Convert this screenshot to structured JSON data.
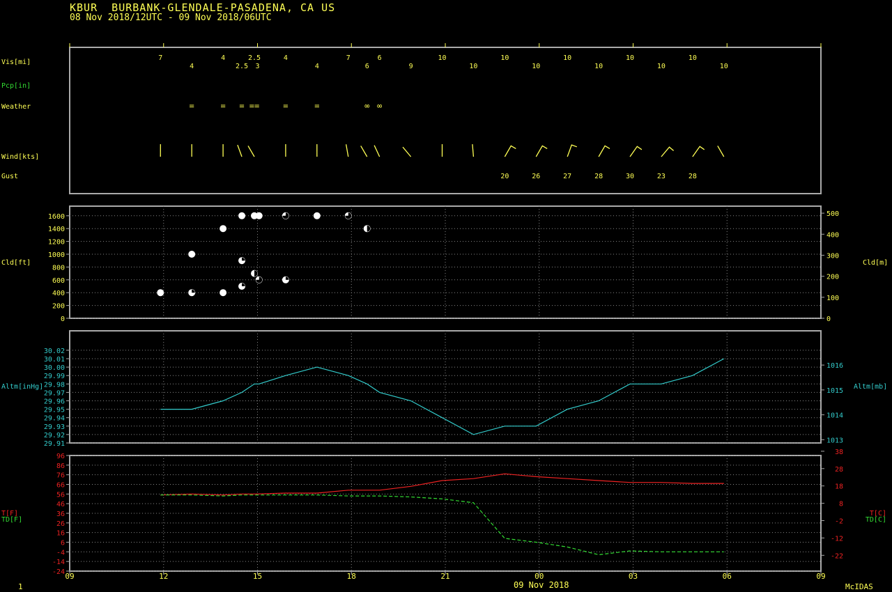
{
  "header": {
    "station": "KBUR  BURBANK-GLENDALE-PASADENA, CA US",
    "period": "08 Nov 2018/12UTC - 09 Nov 2018/06UTC"
  },
  "footer": {
    "frame": "1",
    "credit": "McIDAS",
    "date": "09 Nov 2018"
  },
  "colors": {
    "yellow": "#ffff55",
    "green": "#33dd33",
    "cyan": "#33cccc",
    "red": "#ee2222",
    "grid": "#888888",
    "frame": "#aaaaaa"
  },
  "chart_data": [
    {
      "panel": "surface-weather",
      "type": "table",
      "row_labels": {
        "vis": "Vis[mi]",
        "pcp": "Pcp[in]",
        "weather": "Weather",
        "wind": "Wind[kts]",
        "gust": "Gust"
      },
      "visibility": [
        {
          "t": 11.9,
          "v": "7"
        },
        {
          "t": 12.9,
          "v": "4"
        },
        {
          "t": 13.9,
          "v": "4"
        },
        {
          "t": 14.5,
          "v": "2.5"
        },
        {
          "t": 14.9,
          "v": "2.5"
        },
        {
          "t": 15.0,
          "v": "3"
        },
        {
          "t": 15.9,
          "v": "4"
        },
        {
          "t": 16.9,
          "v": "4"
        },
        {
          "t": 17.9,
          "v": "7"
        },
        {
          "t": 18.5,
          "v": "6"
        },
        {
          "t": 18.9,
          "v": "6"
        },
        {
          "t": 19.9,
          "v": "9"
        },
        {
          "t": 20.9,
          "v": "10"
        },
        {
          "t": 21.9,
          "v": "10"
        },
        {
          "t": 22.9,
          "v": "10"
        },
        {
          "t": 23.9,
          "v": "10"
        },
        {
          "t": 24.9,
          "v": "10"
        },
        {
          "t": 25.9,
          "v": "10"
        },
        {
          "t": 26.9,
          "v": "10"
        },
        {
          "t": 27.9,
          "v": "10"
        },
        {
          "t": 28.9,
          "v": "10"
        },
        {
          "t": 29.9,
          "v": "10"
        }
      ],
      "weather": [
        {
          "t": 12.9,
          "sym": "="
        },
        {
          "t": 13.9,
          "sym": "="
        },
        {
          "t": 14.5,
          "sym": "="
        },
        {
          "t": 14.9,
          "sym": "=="
        },
        {
          "t": 15.9,
          "sym": "="
        },
        {
          "t": 16.9,
          "sym": "="
        },
        {
          "t": 18.5,
          "sym": "∞"
        },
        {
          "t": 18.9,
          "sym": "∞"
        }
      ],
      "wind_barbs": [
        {
          "t": 11.9,
          "dir": 360,
          "spd": 0
        },
        {
          "t": 12.9,
          "dir": 360,
          "spd": 0
        },
        {
          "t": 13.9,
          "dir": 360,
          "spd": 0
        },
        {
          "t": 14.5,
          "dir": 340,
          "spd": 0
        },
        {
          "t": 14.9,
          "dir": 330,
          "spd": 0
        },
        {
          "t": 15.9,
          "dir": 360,
          "spd": 0
        },
        {
          "t": 16.9,
          "dir": 360,
          "spd": 0
        },
        {
          "t": 17.9,
          "dir": 350,
          "spd": 0
        },
        {
          "t": 18.5,
          "dir": 330,
          "spd": 0
        },
        {
          "t": 18.9,
          "dir": 335,
          "spd": 0
        },
        {
          "t": 19.9,
          "dir": 320,
          "spd": 0
        },
        {
          "t": 20.9,
          "dir": 360,
          "spd": 0
        },
        {
          "t": 21.9,
          "dir": 355,
          "spd": 0
        },
        {
          "t": 22.9,
          "dir": 30,
          "spd": 20
        },
        {
          "t": 23.9,
          "dir": 30,
          "spd": 20
        },
        {
          "t": 24.9,
          "dir": 20,
          "spd": 20
        },
        {
          "t": 25.9,
          "dir": 30,
          "spd": 20
        },
        {
          "t": 26.9,
          "dir": 35,
          "spd": 20
        },
        {
          "t": 27.9,
          "dir": 40,
          "spd": 20
        },
        {
          "t": 28.9,
          "dir": 35,
          "spd": 20
        },
        {
          "t": 29.9,
          "dir": 330,
          "spd": 0
        }
      ],
      "gusts": [
        {
          "t": 22.9,
          "v": "20"
        },
        {
          "t": 23.9,
          "v": "26"
        },
        {
          "t": 24.9,
          "v": "27"
        },
        {
          "t": 25.9,
          "v": "28"
        },
        {
          "t": 26.9,
          "v": "30"
        },
        {
          "t": 27.9,
          "v": "23"
        },
        {
          "t": 28.9,
          "v": "28"
        }
      ]
    },
    {
      "panel": "cloud",
      "type": "scatter",
      "ylabel": "Cld[ft]",
      "ylabel_right": "Cld[m]",
      "ylim": [
        0,
        1750
      ],
      "yticks": [
        0,
        200,
        400,
        600,
        800,
        1000,
        1200,
        1400,
        1600
      ],
      "yticks_right": [
        0,
        100,
        200,
        300,
        400,
        500
      ],
      "points": [
        {
          "t": 11.9,
          "ft": 400,
          "cover": 0
        },
        {
          "t": 12.9,
          "ft": 1000,
          "cover": 0
        },
        {
          "t": 12.9,
          "ft": 400,
          "cover": 1
        },
        {
          "t": 13.9,
          "ft": 1400,
          "cover": 0
        },
        {
          "t": 13.9,
          "ft": 400,
          "cover": 0
        },
        {
          "t": 14.5,
          "ft": 1600,
          "cover": 0
        },
        {
          "t": 14.5,
          "ft": 900,
          "cover": 1
        },
        {
          "t": 14.5,
          "ft": 500,
          "cover": 1
        },
        {
          "t": 14.9,
          "ft": 1600,
          "cover": 0
        },
        {
          "t": 14.9,
          "ft": 700,
          "cover": 2
        },
        {
          "t": 15.05,
          "ft": 1600,
          "cover": 0
        },
        {
          "t": 15.05,
          "ft": 600,
          "cover": 3
        },
        {
          "t": 15.9,
          "ft": 1600,
          "cover": 3
        },
        {
          "t": 15.9,
          "ft": 600,
          "cover": 1
        },
        {
          "t": 16.9,
          "ft": 1600,
          "cover": 0
        },
        {
          "t": 17.9,
          "ft": 1600,
          "cover": 3
        },
        {
          "t": 18.5,
          "ft": 1400,
          "cover": 2
        }
      ]
    },
    {
      "panel": "altimeter",
      "type": "line",
      "ylabel": "Altm[inHg]",
      "ylabel_right": "Altm[mb]",
      "ylim": [
        29.91,
        30.02
      ],
      "yticks": [
        "29.91",
        "29.92",
        "29.93",
        "29.94",
        "29.95",
        "29.96",
        "29.97",
        "29.98",
        "29.99",
        "30.00",
        "30.01",
        "30.02"
      ],
      "yticks_right": [
        1013,
        1014,
        1015,
        1016
      ],
      "x": [
        11.9,
        12.9,
        13.9,
        14.5,
        14.9,
        15.05,
        15.9,
        16.9,
        17.9,
        18.5,
        18.9,
        19.9,
        20.9,
        21.9,
        22.9,
        23.9,
        24.9,
        25.9,
        26.9,
        27.9,
        28.9,
        29.9
      ],
      "values": [
        29.95,
        29.95,
        29.96,
        29.97,
        29.98,
        29.98,
        29.99,
        30.0,
        29.99,
        29.98,
        29.97,
        29.96,
        29.94,
        29.92,
        29.93,
        29.93,
        29.95,
        29.96,
        29.98,
        29.98,
        29.99,
        30.01
      ]
    },
    {
      "panel": "temperature",
      "type": "line",
      "ylabel": "T[F]",
      "ylabel2": "TD[F]",
      "ylabel_right": "T[C]",
      "ylabel_right2": "TD[C]",
      "ylim": [
        -24,
        96
      ],
      "yticks": [
        -24,
        -14,
        -4,
        6,
        16,
        26,
        36,
        46,
        56,
        66,
        76,
        86,
        96
      ],
      "yticks_right": [
        -22,
        -12,
        -2,
        8,
        18,
        28,
        38
      ],
      "x": [
        11.9,
        12.9,
        13.9,
        14.5,
        14.9,
        15.9,
        16.9,
        17.9,
        18.9,
        19.9,
        20.9,
        21.9,
        22.9,
        23.9,
        24.9,
        25.9,
        26.9,
        27.9,
        28.9,
        29.9
      ],
      "series": [
        {
          "name": "T[F]",
          "values": [
            55,
            56,
            55,
            56,
            56,
            57,
            57,
            60,
            60,
            64,
            70,
            72,
            77,
            74,
            72,
            70,
            68,
            68,
            67,
            67
          ]
        },
        {
          "name": "TD[F]",
          "values": [
            55,
            55,
            54,
            55,
            55,
            55,
            55,
            54,
            54,
            53,
            51,
            47,
            10,
            6,
            1,
            -7,
            -3,
            -4,
            -4,
            -4
          ]
        }
      ],
      "xticks": [
        "09",
        "12",
        "15",
        "18",
        "21",
        "00",
        "03",
        "06",
        "09"
      ]
    }
  ]
}
